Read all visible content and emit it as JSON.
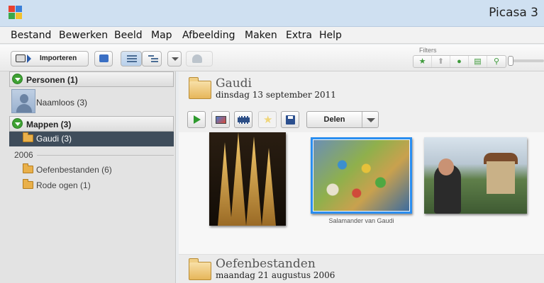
{
  "window": {
    "title": "Picasa 3"
  },
  "menu": [
    "Bestand",
    "Bewerken",
    "Beeld",
    "Map",
    "Afbeelding",
    "Maken",
    "Extra",
    "Help"
  ],
  "toolbar": {
    "import_label": "Importeren",
    "filters_label": "Filters"
  },
  "sidebar": {
    "people_header": "Personen (1)",
    "person_name": "Naamloos (3)",
    "folders_header": "Mappen (3)",
    "selected_folder": "Gaudi (3)",
    "year": "2006",
    "folders": [
      "Oefenbestanden (6)",
      "Rode ogen (1)"
    ]
  },
  "album": {
    "title": "Gaudi",
    "date": "dinsdag 13 september 2011",
    "share_label": "Delen",
    "selected_caption": "Salamander van Gaudi"
  },
  "album2": {
    "title": "Oefenbestanden",
    "date": "maandag 21 augustus 2006"
  },
  "colors": {
    "accent": "#2a8ef0",
    "selected_row": "#3f4d5b",
    "green": "#3ea133"
  }
}
